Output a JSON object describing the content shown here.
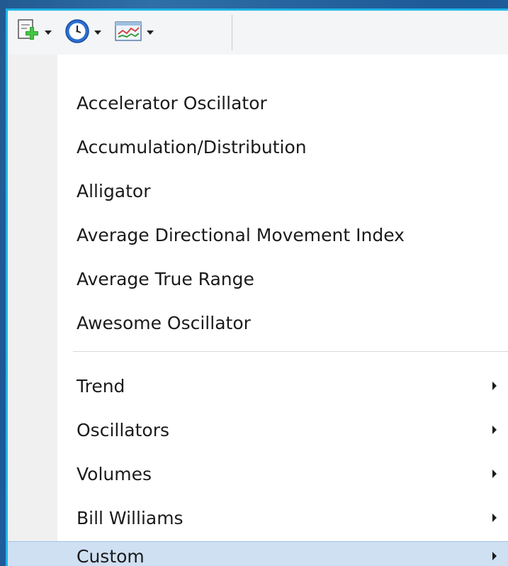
{
  "toolbar": {
    "buttons": [
      {
        "icon": "new-chart-icon",
        "dropdown": true
      },
      {
        "icon": "clock-icon",
        "dropdown": true
      },
      {
        "icon": "indicators-icon",
        "dropdown": true
      }
    ]
  },
  "menu": {
    "indicators": [
      {
        "label": "Accelerator Oscillator"
      },
      {
        "label": "Accumulation/Distribution"
      },
      {
        "label": "Alligator"
      },
      {
        "label": "Average Directional Movement Index"
      },
      {
        "label": "Average True Range"
      },
      {
        "label": "Awesome Oscillator"
      }
    ],
    "categories": [
      {
        "label": "Trend",
        "submenu": true
      },
      {
        "label": "Oscillators",
        "submenu": true
      },
      {
        "label": "Volumes",
        "submenu": true
      },
      {
        "label": "Bill Williams",
        "submenu": true
      },
      {
        "label": "Custom",
        "submenu": true,
        "highlighted": true
      }
    ]
  },
  "colors": {
    "highlight": "#cfe0f3",
    "frame_accent": "#1fb6e8"
  }
}
